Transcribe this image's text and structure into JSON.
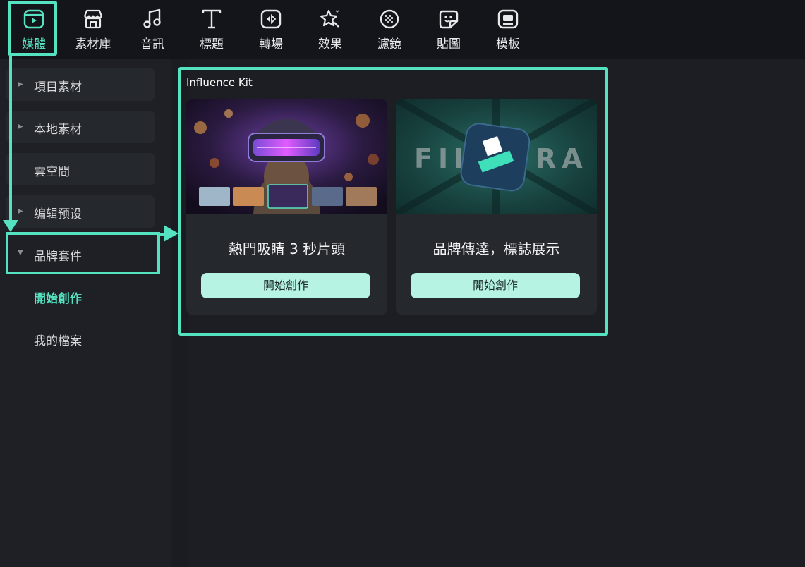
{
  "toolbar": {
    "tabs": [
      {
        "label": "媒體",
        "icon": "media-icon",
        "active": true
      },
      {
        "label": "素材庫",
        "icon": "store-icon"
      },
      {
        "label": "音訊",
        "icon": "music-note-icon"
      },
      {
        "label": "標題",
        "icon": "title-t-icon"
      },
      {
        "label": "轉場",
        "icon": "transition-icon"
      },
      {
        "label": "效果",
        "icon": "effects-icon"
      },
      {
        "label": "濾鏡",
        "icon": "filter-icon"
      },
      {
        "label": "貼圖",
        "icon": "sticker-icon"
      },
      {
        "label": "模板",
        "icon": "template-icon"
      }
    ]
  },
  "sidebar": {
    "items": [
      {
        "label": "項目素材",
        "expander": "collapsed"
      },
      {
        "label": "本地素材",
        "expander": "collapsed"
      },
      {
        "label": "雲空間"
      },
      {
        "label": "编辑预设",
        "expander": "collapsed"
      },
      {
        "label": "品牌套件",
        "expander": "expanded"
      }
    ],
    "subitems": [
      {
        "label": "開始創作",
        "active": true
      },
      {
        "label": "我的檔案"
      }
    ]
  },
  "main": {
    "section_title": "Influence Kit",
    "cards": [
      {
        "title": "熱門吸睛 3 秒片頭",
        "button": "開始創作"
      },
      {
        "title": "品牌傳達，標誌展示",
        "button": "開始創作",
        "thumb_text_left": "FIL",
        "thumb_text_right": "RA"
      }
    ]
  },
  "colors": {
    "accent": "#57e3c1",
    "highlight_border": "#55e2c1",
    "button_bg": "#b6f3e3",
    "panel_bg": "#1e2025",
    "toolbar_bg": "#13151a"
  }
}
